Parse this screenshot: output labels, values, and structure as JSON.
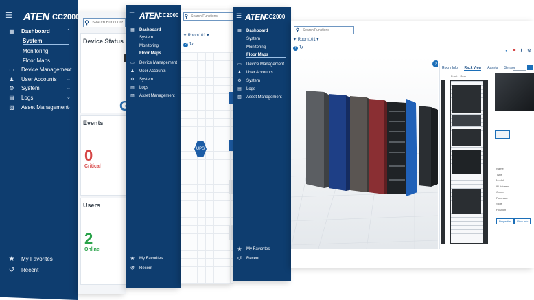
{
  "brand": {
    "logo": "ATEN",
    "model": "CC2000"
  },
  "menu": {
    "dashboard": "Dashboard",
    "system": "System",
    "monitoring": "Monitoring",
    "floor_maps": "Floor Maps",
    "device_management": "Device Management",
    "user_accounts": "User Accounts",
    "system_menu": "System",
    "logs": "Logs",
    "asset_management": "Asset Management",
    "favorites": "My Favorites",
    "recent": "Recent"
  },
  "search": {
    "placeholder": "Search Functions"
  },
  "dashboard": {
    "device_status_title": "Device Status",
    "device_status_glyph": "G",
    "events_title": "Events",
    "events_count": "0",
    "events_label": "Critical",
    "users_title": "Users",
    "users_count": "2",
    "users_label": "Online"
  },
  "floor_map": {
    "room_selector": "Room101",
    "ups_label": "UPS",
    "panel_tabs": [
      "Room Info",
      "Rack View",
      "Assets",
      "Sensor"
    ],
    "rack_view_options": [
      "Front",
      "Rear"
    ],
    "detail_fields": [
      "Name",
      "Type",
      "Model",
      "IP Address",
      "Owner",
      "Purchase",
      "Slots",
      "Position"
    ],
    "buttons": [
      "Properties",
      "View Info"
    ]
  },
  "colors": {
    "sidebar": "#0e3d6f",
    "accent_red": "#d64545",
    "accent_green": "#2aa34a",
    "grid": "#e6eaef"
  }
}
